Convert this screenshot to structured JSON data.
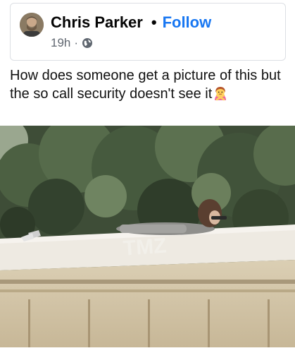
{
  "post": {
    "author": "Chris Parker",
    "separator": "•",
    "follow_label": "Follow",
    "time": "19h",
    "meta_separator": "·",
    "audience_icon": "globe-icon",
    "text": "How does someone get a picture of this but the so call security doesn't see it",
    "emoji": "woman-gesturing-no-emoji"
  },
  "photo": {
    "watermark": "TMZ"
  },
  "colors": {
    "link": "#1877f2",
    "meta": "#606770",
    "card_border": "#dcdfe4"
  }
}
